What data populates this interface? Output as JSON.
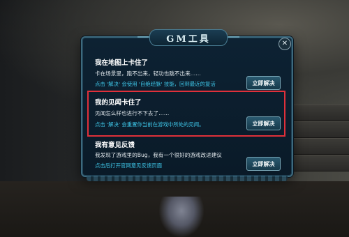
{
  "dialog": {
    "title": "GM工具",
    "close_icon": "close-icon",
    "button_label": "立即解决",
    "sections": [
      {
        "heading": "我在地图上卡住了",
        "description": "卡在场景里，跑不出来，轻功也跳不出来……",
        "hint": "点击 '解决' 会使用 '自绝经脉' 技能，回到最近的复活"
      },
      {
        "heading": "我的见闻卡住了",
        "description": "见闻怎么样也进行不下去了……",
        "hint": "点击 '解决' 会重置你当前在游戏中所处的见闻。",
        "highlighted": true
      },
      {
        "heading": "我有意见反馈",
        "description": "我发现了游戏里的Bug，我有一个很好的游戏改进建议",
        "hint": "点击后打开官网意见反馈页面"
      }
    ]
  },
  "colors": {
    "heading": "#ffffff",
    "hint": "#3ec6e8",
    "highlight_border": "#e0303a",
    "panel_bg": "#0d2233"
  }
}
